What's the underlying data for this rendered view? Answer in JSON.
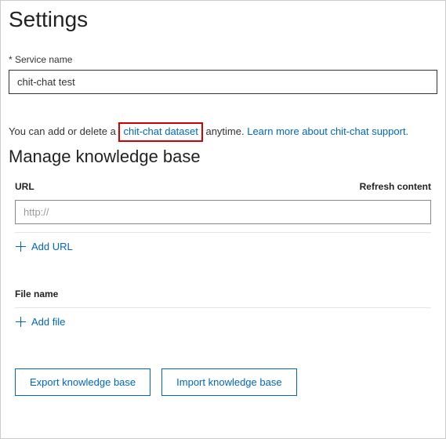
{
  "settings": {
    "title": "Settings",
    "service_name_label": "* Service name",
    "service_name_value": "chit-chat test"
  },
  "hint": {
    "prefix": "You can add or delete a ",
    "dataset_link": "chit-chat dataset",
    "middle": " anytime. ",
    "learn_more": "Learn more about chit-chat support."
  },
  "manage": {
    "title": "Manage knowledge base",
    "url_label": "URL",
    "refresh_label": "Refresh content",
    "url_placeholder": "http://",
    "add_url": "Add URL",
    "file_name_label": "File name",
    "add_file": "Add file"
  },
  "buttons": {
    "export": "Export knowledge base",
    "import": "Import knowledge base"
  }
}
